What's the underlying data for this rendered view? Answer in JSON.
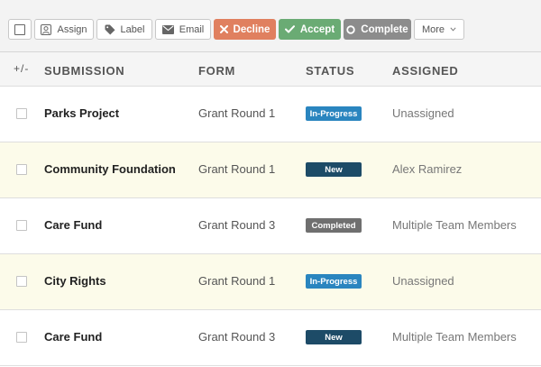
{
  "toolbar": {
    "assign_label": "Assign",
    "label_label": "Label",
    "email_label": "Email",
    "decline_label": "Decline",
    "accept_label": "Accept",
    "complete_label": "Complete",
    "more_label": "More"
  },
  "colors": {
    "decline": "#e0805f",
    "accept": "#6aab74",
    "complete": "#8c8c8c",
    "status_in_progress": "#2a85bf",
    "status_new": "#1d4b67",
    "status_completed": "#6f6f6f",
    "highlight_row": "#fcfbea"
  },
  "table": {
    "toggle_all": "+/-",
    "headers": {
      "submission": "SUBMISSION",
      "form": "FORM",
      "status": "STATUS",
      "assigned": "ASSIGNED"
    },
    "rows": [
      {
        "submission": "Parks Project",
        "form": "Grant Round 1",
        "status": "In-Progress",
        "status_key": "in_progress",
        "assigned": "Unassigned",
        "highlighted": false
      },
      {
        "submission": "Community Foundation",
        "form": "Grant Round 1",
        "status": "New",
        "status_key": "new",
        "assigned": "Alex Ramirez",
        "highlighted": true
      },
      {
        "submission": "Care Fund",
        "form": "Grant Round 3",
        "status": "Completed",
        "status_key": "completed",
        "assigned": "Multiple Team Members",
        "highlighted": false
      },
      {
        "submission": "City Rights",
        "form": "Grant Round 1",
        "status": "In-Progress",
        "status_key": "in_progress",
        "assigned": "Unassigned",
        "highlighted": true
      },
      {
        "submission": "Care Fund",
        "form": "Grant Round 3",
        "status": "New",
        "status_key": "new",
        "assigned": "Multiple Team Members",
        "highlighted": false
      }
    ]
  }
}
